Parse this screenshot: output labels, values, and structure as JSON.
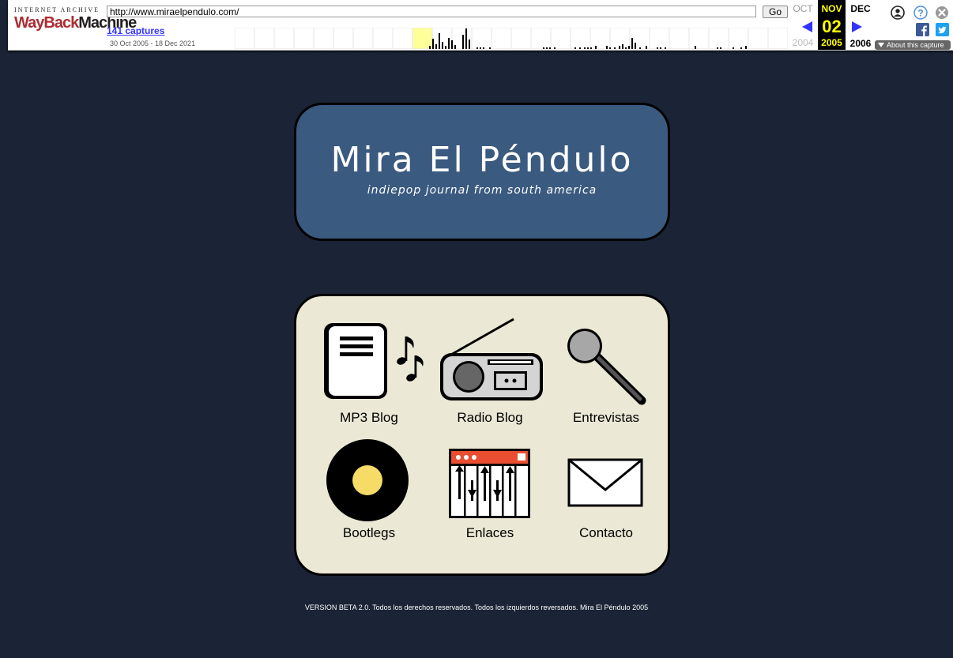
{
  "wayback": {
    "logo_top": "INTERNET ARCHIVE",
    "logo_part1": "WayBack",
    "logo_part2": "Machine",
    "url_value": "http://www.miraelpendulo.com/",
    "go_label": "Go",
    "captures_label": "141 captures",
    "date_range": "30 Oct 2005 - 18 Dec 2021",
    "prev_month": "OCT",
    "prev_year": "2004",
    "current_month": "NOV",
    "current_day": "02",
    "current_year": "2005",
    "next_month": "DEC",
    "next_year": "2006",
    "about_label": "About this capture",
    "accent_color": "#ffff00"
  },
  "site": {
    "title": "Mira El Péndulo",
    "tagline": "indiepop journal from south america",
    "menu": [
      {
        "label": "MP3 Blog",
        "icon": "music-page-icon"
      },
      {
        "label": "Radio Blog",
        "icon": "radio-icon"
      },
      {
        "label": "Entrevistas",
        "icon": "microphone-icon"
      },
      {
        "label": "Bootlegs",
        "icon": "vinyl-record-icon"
      },
      {
        "label": "Enlaces",
        "icon": "synthesizer-icon"
      },
      {
        "label": "Contacto",
        "icon": "envelope-icon"
      }
    ],
    "footer": "VERSION BETA 2.0. Todos los derechos reservados. Todos los izquierdos reversados. Mira El Péndulo 2005"
  },
  "colors": {
    "page_bg": "#1a2436",
    "header_bg": "#3a5a80",
    "menu_bg": "#ebe9d5"
  }
}
